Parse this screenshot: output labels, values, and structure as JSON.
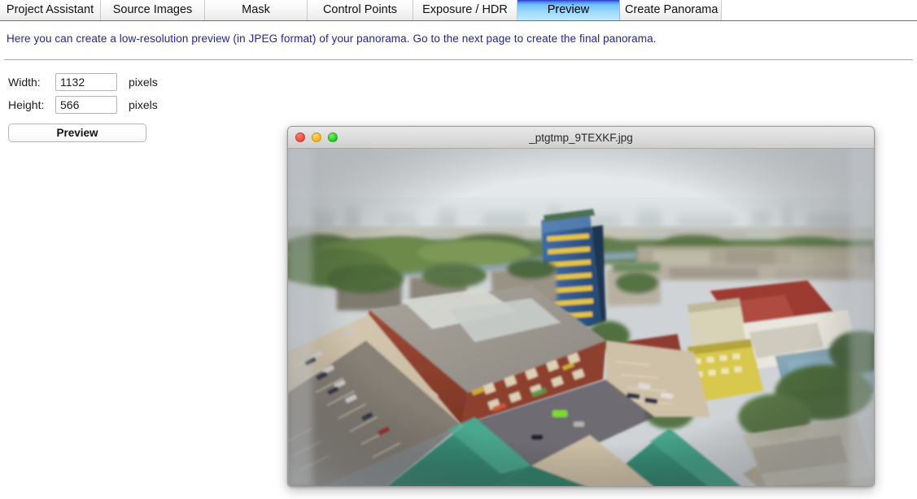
{
  "tabs": [
    {
      "label": "Project Assistant",
      "selected": false
    },
    {
      "label": "Source Images",
      "selected": false
    },
    {
      "label": "Mask",
      "selected": false
    },
    {
      "label": "Control Points",
      "selected": false
    },
    {
      "label": "Exposure / HDR",
      "selected": false
    },
    {
      "label": "Preview",
      "selected": true
    },
    {
      "label": "Create Panorama",
      "selected": false
    }
  ],
  "instruction": "Here you can create a low-resolution preview (in JPEG format) of your panorama. Go to the next page to create the final panorama.",
  "form": {
    "width_label": "Width:",
    "width_value": "1132",
    "width_unit": "pixels",
    "height_label": "Height:",
    "height_value": "566",
    "height_unit": "pixels",
    "preview_button": "Preview"
  },
  "image_window": {
    "title": "_ptgtmp_9TEXKF.jpg",
    "traffic_lights": [
      "close-red",
      "minimize-yellow",
      "zoom-green"
    ],
    "content_description": "Aerial panorama of an industrial city district: hazy sky over distant skyline, a river with green treed banks, a blue-and-yellow high-rise tower, a large red-brick warehouse with gray flat roof, wide parking lots with cars, teal-green pitched roofs in the foreground, yellow and red-roofed buildings at right."
  },
  "colors": {
    "instruction_text": "#2222aa",
    "selected_tab_top": "#2a2fc0",
    "selected_tab_bottom": "#bfeafd",
    "light_red": "#f04436",
    "light_yellow": "#f5b21c",
    "light_green": "#23c721"
  }
}
